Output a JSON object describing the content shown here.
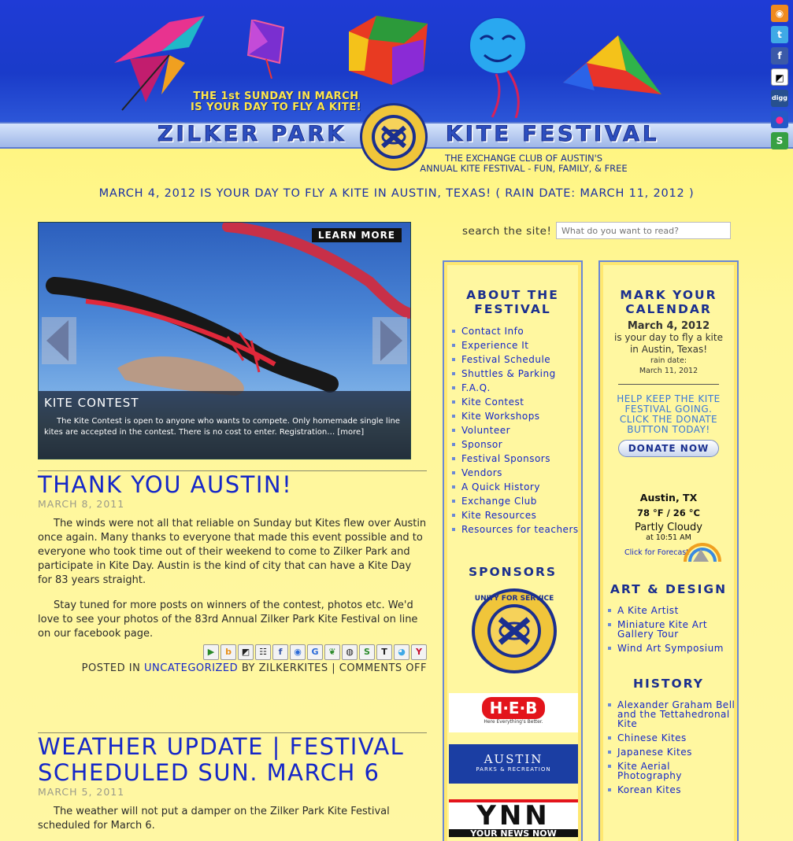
{
  "header": {
    "tagline_line1": "THE 1st SUNDAY IN MARCH",
    "tagline_line2": "IS YOUR DAY TO FLY A KITE!",
    "title_left": "ZILKER PARK",
    "title_right": "KITE FESTIVAL",
    "seal_top": "UNITY FOR SERVICE",
    "seal_bottom": "NATIONAL EXCHANGE CLUB",
    "sub_line1": "THE EXCHANGE CLUB OF AUSTIN'S",
    "sub_line2": "ANNUAL KITE FESTIVAL - FUN, FAMILY, & FREE"
  },
  "social_icons": [
    "rss-icon",
    "twitter-icon",
    "facebook-icon",
    "delicious-icon",
    "digg-icon",
    "flickr-icon",
    "stumbleupon-icon"
  ],
  "announcement": "MARCH 4, 2012 IS YOUR DAY TO FLY A KITE IN AUSTIN, TEXAS! ( RAIN DATE: MARCH 11, 2012 )",
  "slider": {
    "learn_more": "LEARN MORE",
    "caption_title": "KITE CONTEST",
    "caption_text": "The Kite Contest is open to anyone who wants to compete.  Only homemade single line kites are accepted in the contest. There is no cost to enter.  Registration…",
    "caption_more": "[more]"
  },
  "posts": [
    {
      "title": "THANK YOU AUSTIN!",
      "date": "MARCH 8, 2011",
      "paragraphs": [
        "The winds were not all that reliable on Sunday but Kites flew over Austin once again. Many thanks to everyone that made this event possible and to everyone who took time out of their weekend to come to Zilker Park and participate in Kite Day.  Austin is the kind of city that can have a Kite Day for 83 years straight.",
        "Stay tuned for more posts on winners of the contest, photos etc. We'd love to see your photos of the 83rd Annual Zilker Park Kite Festival on line on our facebook page."
      ],
      "posted_in": "POSTED IN",
      "category": "UNCATEGORIZED",
      "by": "BY ZILKERKITES",
      "separator": "|",
      "comments": "COMMENTS OFF"
    },
    {
      "title": "WEATHER UPDATE | FESTIVAL SCHEDULED SUN. MARCH 6",
      "date": "MARCH 5, 2011",
      "paragraphs": [
        "The weather will not put a damper on the Zilker Park Kite Festival scheduled for March 6."
      ]
    }
  ],
  "share_icons": [
    "▶",
    "b",
    "◩",
    "☷",
    "f",
    "◉",
    "G",
    "❦",
    "◍",
    "S",
    "T",
    "◕",
    "Y"
  ],
  "search": {
    "label": "search the site!",
    "placeholder": "What do you want to read?"
  },
  "about": {
    "title": "ABOUT THE FESTIVAL",
    "items": [
      "Contact Info",
      "Experience It",
      "Festival Schedule",
      "Shuttles & Parking",
      "F.A.Q.",
      "Kite Contest",
      "Kite Workshops",
      "Volunteer",
      "Sponsor",
      "Festival Sponsors",
      "Vendors",
      "A Quick History",
      "Exchange Club",
      "Kite Resources",
      "Resources for teachers"
    ]
  },
  "sponsors": {
    "title": "SPONSORS",
    "seal_text": "UNITY FOR SERVICE",
    "heb": "H·E·B",
    "heb_tag": "Here Everything's Better.",
    "austin": "AUSTIN",
    "austin_sub": "PARKS & RECREATION",
    "ynn": "YNN",
    "ynn_sub": "YOUR NEWS NOW"
  },
  "calendar": {
    "title": "MARK YOUR CALENDAR",
    "date": "March 4, 2012",
    "line1": "is your day to fly a kite",
    "line2": "in Austin, Texas!",
    "rain_label": "rain date:",
    "rain_date": "March 11, 2012",
    "donate_text": "HELP KEEP THE KITE FESTIVAL GOING. CLICK THE DONATE BUTTON TODAY!",
    "donate_button": "DONATE NOW"
  },
  "weather": {
    "city": "Austin, TX",
    "temp": "78 °F / 26 °C",
    "condition": "Partly Cloudy",
    "time": "at 10:51 AM",
    "forecast": "Click for Forecast"
  },
  "art": {
    "title": "ART & DESIGN",
    "items": [
      "A Kite Artist",
      "Miniature Kite Art Gallery Tour",
      "Wind Art Symposium"
    ]
  },
  "history": {
    "title": "HISTORY",
    "items": [
      "Alexander Graham Bell and the Tettahedronal Kite",
      "Chinese Kites",
      "Japanese Kites",
      "Kite Aerial Photography",
      "Korean Kites"
    ]
  }
}
